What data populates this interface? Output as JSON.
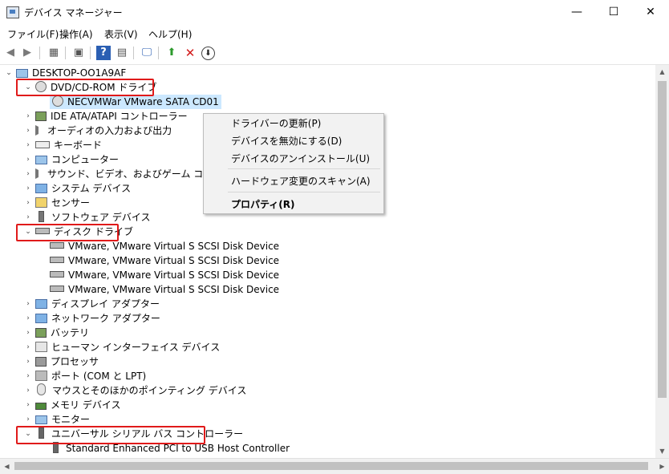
{
  "window": {
    "title": "デバイス マネージャー",
    "minimize": "—",
    "maximize": "☐",
    "close": "✕"
  },
  "menu": [
    "ファイル(F)",
    "操作(A)",
    "表示(V)",
    "ヘルプ(H)"
  ],
  "toolbar": {
    "back": "◀",
    "forward": "▶",
    "props": "▦",
    "refresh": "▣",
    "help": "?",
    "view": "▤",
    "monitor": "🖵",
    "update": "⬆",
    "remove": "✕",
    "download": "⬇"
  },
  "tree": {
    "root": "DESKTOP-OO1A9AF",
    "dvd": "DVD/CD-ROM ドライブ",
    "dvd_child": "NECVMWar VMware SATA CD01",
    "ide": "IDE ATA/ATAPI コントローラー",
    "audio_io": "オーディオの入力および出力",
    "keyboard": "キーボード",
    "computer": "コンピューター",
    "sound": "サウンド、ビデオ、およびゲーム コントローラー",
    "system": "システム デバイス",
    "sensor": "センサー",
    "software": "ソフトウェア デバイス",
    "disk": "ディスク ドライブ",
    "disk_children": [
      "VMware, VMware Virtual S SCSI Disk Device",
      "VMware, VMware Virtual S SCSI Disk Device",
      "VMware, VMware Virtual S SCSI Disk Device",
      "VMware, VMware Virtual S SCSI Disk Device"
    ],
    "display": "ディスプレイ アダプター",
    "network": "ネットワーク アダプター",
    "battery": "バッテリ",
    "hid": "ヒューマン インターフェイス デバイス",
    "processor": "プロセッサ",
    "port": "ポート (COM と LPT)",
    "mouse": "マウスとそのほかのポインティング デバイス",
    "memory": "メモリ デバイス",
    "monitor": "モニター",
    "usb": "ユニバーサル シリアル バス コントローラー",
    "usb_child": "Standard Enhanced PCI to USB Host Controller"
  },
  "context_menu": {
    "update_driver": "ドライバーの更新(P)",
    "disable": "デバイスを無効にする(D)",
    "uninstall": "デバイスのアンインストール(U)",
    "scan": "ハードウェア変更のスキャン(A)",
    "properties": "プロパティ(R)"
  },
  "colors": {
    "highlight": "#e01a1a",
    "selection": "#cce8ff"
  }
}
